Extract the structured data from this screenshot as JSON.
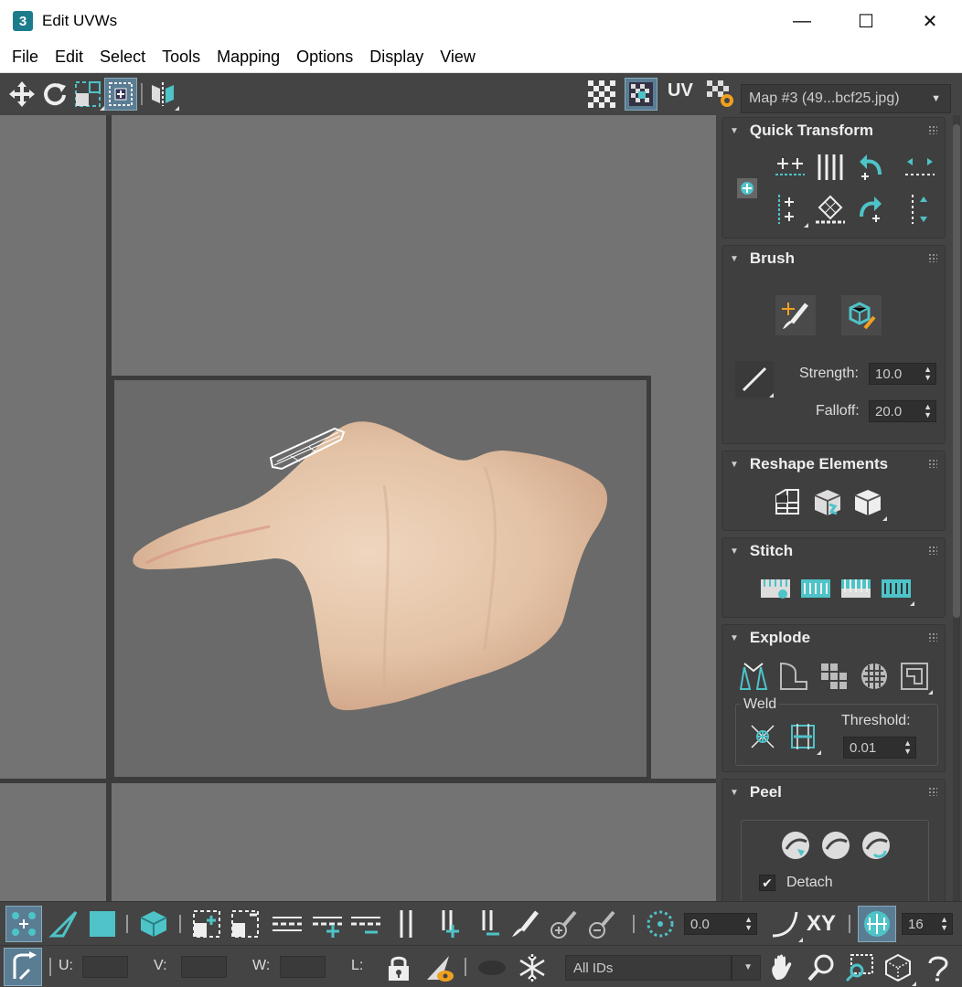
{
  "window": {
    "title": "Edit UVWs",
    "app_badge": "3",
    "minimize": "—",
    "maximize": "☐",
    "close": "✕"
  },
  "menu": [
    "File",
    "Edit",
    "Select",
    "Tools",
    "Mapping",
    "Options",
    "Display",
    "View"
  ],
  "toolbar": {
    "uv_label": "UV",
    "map_selector": "Map #3 (49...bcf25.jpg)"
  },
  "rollouts": {
    "quick_transform": {
      "title": "Quick Transform"
    },
    "brush": {
      "title": "Brush",
      "strength_label": "Strength:",
      "strength_value": "10.0",
      "falloff_label": "Falloff:",
      "falloff_value": "20.0"
    },
    "reshape": {
      "title": "Reshape Elements"
    },
    "stitch": {
      "title": "Stitch"
    },
    "explode": {
      "title": "Explode",
      "weld_label": "Weld",
      "threshold_label": "Threshold:",
      "threshold_value": "0.01"
    },
    "peel": {
      "title": "Peel",
      "detach_label": "Detach"
    }
  },
  "bottom": {
    "angle_value": "0.0",
    "xy_label": "XY",
    "grid_value": "16",
    "u_label": "U:",
    "v_label": "V:",
    "w_label": "W:",
    "l_label": "L:",
    "ids_select": "All IDs"
  },
  "colors": {
    "accent": "#4ec3c8",
    "panel_bg": "#444444",
    "viewport_bg": "#737373",
    "highlight": "#f0a020"
  }
}
